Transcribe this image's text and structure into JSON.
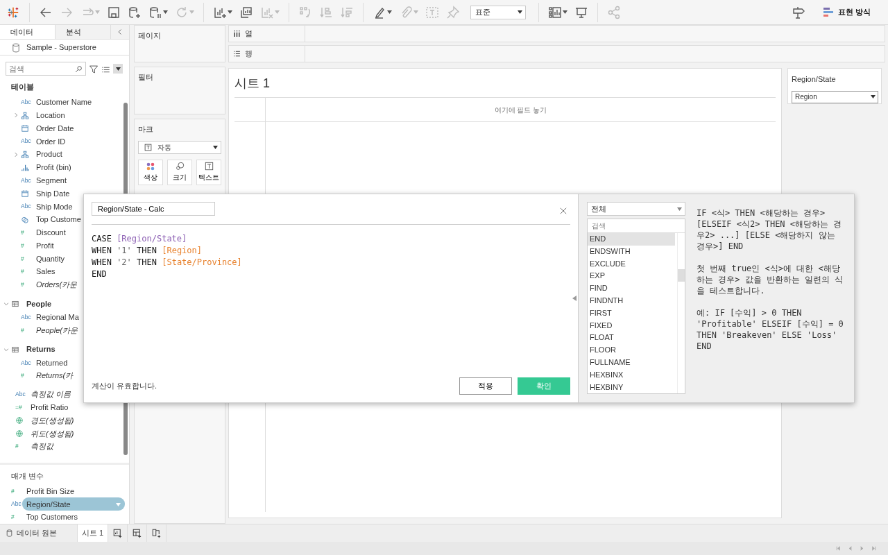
{
  "toolbar": [
    {
      "kind": "logo"
    },
    {
      "kind": "separator"
    },
    {
      "kind": "back",
      "disabled": false,
      "dropdown": false
    },
    {
      "kind": "forward",
      "disabled": true,
      "dropdown": false
    },
    {
      "kind": "redo",
      "disabled": true,
      "dropdown": true
    },
    {
      "kind": "save",
      "disabled": false,
      "dropdown": false
    },
    {
      "kind": "new-datasource",
      "disabled": false,
      "dropdown": false
    },
    {
      "kind": "pause",
      "disabled": false,
      "dropdown": true
    },
    {
      "kind": "refresh",
      "disabled": true,
      "dropdown": true
    },
    {
      "kind": "separator"
    },
    {
      "kind": "new-sheet",
      "disabled": false,
      "dropdown": true
    },
    {
      "kind": "duplicate",
      "disabled": false,
      "dropdown": false
    },
    {
      "kind": "clear",
      "disabled": true,
      "dropdown": true
    },
    {
      "kind": "separator"
    },
    {
      "kind": "swap",
      "disabled": true,
      "dropdown": false
    },
    {
      "kind": "sort-asc",
      "disabled": true,
      "dropdown": false
    },
    {
      "kind": "sort-desc",
      "disabled": true,
      "dropdown": false
    },
    {
      "kind": "separator"
    },
    {
      "kind": "highlight",
      "disabled": false,
      "dropdown": true
    },
    {
      "kind": "annotate",
      "disabled": true,
      "dropdown": true
    },
    {
      "kind": "label",
      "disabled": true,
      "dropdown": false
    },
    {
      "kind": "pin",
      "disabled": true,
      "dropdown": false
    },
    {
      "kind": "select",
      "value": "표준"
    },
    {
      "kind": "separator"
    },
    {
      "kind": "show-me",
      "disabled": false,
      "dropdown": true
    },
    {
      "kind": "present",
      "disabled": false,
      "dropdown": false
    },
    {
      "kind": "separator"
    },
    {
      "kind": "share",
      "disabled": true,
      "dropdown": false
    }
  ],
  "show_me_button": "표현 방식",
  "sidebar": {
    "tabs": [
      {
        "label": "데이터",
        "selected": true
      },
      {
        "label": "분석",
        "selected": false
      }
    ],
    "datasource": "Sample - Superstore",
    "search": {
      "placeholder": "검색"
    },
    "section": "테이블",
    "fields": [
      {
        "name": "Customer Name",
        "glyph": "Abc"
      },
      {
        "name": "Location",
        "kind": "hierarchy",
        "expanded": false
      },
      {
        "name": "Order Date",
        "kind": "date"
      },
      {
        "name": "Order ID",
        "glyph": "Abc"
      },
      {
        "name": "Product",
        "kind": "hierarchy",
        "expanded": false
      },
      {
        "name": "Profit (bin)",
        "kind": "bin"
      },
      {
        "name": "Segment",
        "glyph": "Abc"
      },
      {
        "name": "Ship Date",
        "kind": "date"
      },
      {
        "name": "Ship Mode",
        "glyph": "Abc"
      },
      {
        "name": "Top Custome",
        "kind": "set"
      },
      {
        "name": "Discount",
        "glyph": "#"
      },
      {
        "name": "Profit",
        "glyph": "#"
      },
      {
        "name": "Quantity",
        "glyph": "#"
      },
      {
        "name": "Sales",
        "glyph": "#"
      },
      {
        "name": "Orders(카운",
        "glyph": "#",
        "italic": true
      },
      {
        "name": "People",
        "kind": "table",
        "expanded": true,
        "children": [
          {
            "name": "Regional Ma",
            "glyph": "Abc"
          },
          {
            "name": "People(카운",
            "glyph": "#",
            "italic": true
          }
        ]
      },
      {
        "name": "Returns",
        "kind": "table",
        "expanded": true,
        "children": [
          {
            "name": "Returned",
            "glyph": "Abc"
          },
          {
            "name": "Returns(카",
            "glyph": "#",
            "italic": true
          }
        ]
      },
      {
        "name": "측정값 이름",
        "glyph": "Abc",
        "italic": true,
        "outer": true
      },
      {
        "name": "Profit Ratio",
        "glyph": "=#",
        "outer": true
      },
      {
        "name": "경도(생성됨)",
        "kind": "geo",
        "italic": true,
        "outer": true
      },
      {
        "name": "위도(생성됨)",
        "kind": "geo",
        "italic": true,
        "outer": true
      },
      {
        "name": "측정값",
        "glyph": "#",
        "italic": true,
        "outer": true
      }
    ],
    "parameters_title": "매개 변수",
    "parameters": [
      {
        "name": "Profit Bin Size",
        "glyph": "#",
        "selected": false
      },
      {
        "name": "Region/State",
        "glyph": "Abc",
        "selected": true
      },
      {
        "name": "Top Customers",
        "glyph": "#",
        "selected": false
      }
    ]
  },
  "shelves": {
    "pages": "페이지",
    "filters": "필터",
    "marks": {
      "title": "마크",
      "type": "자동",
      "buttons": [
        "색상",
        "크기",
        "텍스트"
      ]
    },
    "columns": "열",
    "rows": "행"
  },
  "sheet": {
    "title": "시트 1",
    "drop_hint": "여기에 필드 놓기"
  },
  "parameter_card": {
    "title": "Region/State",
    "value": "Region"
  },
  "dialog": {
    "name": "Region/State - Calc",
    "formula": [
      [
        {
          "text": "CASE",
          "kind": "keyword"
        },
        {
          "text": "[Region/State]",
          "kind": "parameter"
        }
      ],
      [
        {
          "text": "WHEN",
          "kind": "keyword"
        },
        {
          "text": "'1'",
          "kind": "string"
        },
        {
          "text": "THEN",
          "kind": "keyword"
        },
        {
          "text": "[Region]",
          "kind": "field"
        }
      ],
      [
        {
          "text": "WHEN",
          "kind": "keyword"
        },
        {
          "text": "'2'",
          "kind": "string"
        },
        {
          "text": "THEN",
          "kind": "keyword"
        },
        {
          "text": "[State/Province]",
          "kind": "field"
        }
      ],
      [
        {
          "text": "END",
          "kind": "keyword"
        }
      ]
    ],
    "status": "계산이 유효합니다.",
    "buttons": [
      {
        "label": "적용",
        "primary": false
      },
      {
        "label": "확인",
        "primary": true
      }
    ],
    "category": "전체",
    "function_search": {
      "placeholder": "검색"
    },
    "functions": [
      {
        "name": "END",
        "selected": true
      },
      {
        "name": "ENDSWITH",
        "selected": false
      },
      {
        "name": "EXCLUDE",
        "selected": false
      },
      {
        "name": "EXP",
        "selected": false
      },
      {
        "name": "FIND",
        "selected": false
      },
      {
        "name": "FINDNTH",
        "selected": false
      },
      {
        "name": "FIRST",
        "selected": false
      },
      {
        "name": "FIXED",
        "selected": false
      },
      {
        "name": "FLOAT",
        "selected": false
      },
      {
        "name": "FLOOR",
        "selected": false
      },
      {
        "name": "FULLNAME",
        "selected": false
      },
      {
        "name": "HEXBINX",
        "selected": false
      },
      {
        "name": "HEXBINY",
        "selected": false
      }
    ],
    "description": [
      "IF <식> THEN <해당하는 경우> [ELSEIF <식2> THEN <해당하는 경우2> ...] [ELSE <해당하지 않는 경우>] END",
      "첫 번째 true인 <식>에 대한 <해당하는 경우> 값을 반환하는 일련의 식을 테스트합니다.",
      "예: IF [수익] > 0 THEN 'Profitable' ELSEIF [수익] = 0 THEN 'Breakeven' ELSE 'Loss' END"
    ]
  },
  "bottom_tabs": [
    {
      "label": "데이터 원본",
      "kind": "datasource",
      "selected": false
    },
    {
      "label": "시트 1",
      "kind": "sheet",
      "selected": true
    }
  ]
}
